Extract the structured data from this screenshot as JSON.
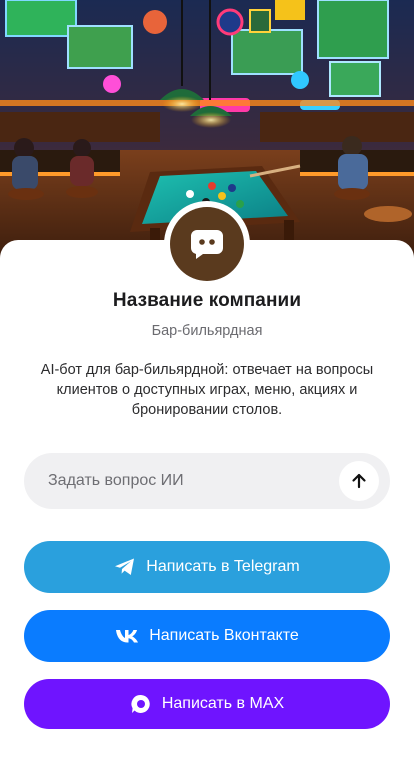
{
  "hero": {
    "image_label": "bar-billiards-interior"
  },
  "company": {
    "name": "Название компании",
    "category": "Бар-бильярдная",
    "description": "AI-бот для бар-бильярдной: отвечает на вопросы клиентов о доступных играх, меню, акциях и бронировании столов.",
    "avatar_icon": "chat-bubble-icon",
    "avatar_color": "#5a3a1e"
  },
  "ask": {
    "placeholder": "Задать вопрос ИИ",
    "value": "",
    "send_icon": "arrow-up-icon"
  },
  "buttons": {
    "telegram": {
      "label": "Написать в Telegram",
      "color": "#2aa0dd",
      "icon": "telegram-icon"
    },
    "vk": {
      "label": "Написать Вконтакте",
      "color": "#0a7cff",
      "icon": "vk-icon"
    },
    "max": {
      "label": "Написать в MAX",
      "color": "#6f14ff",
      "icon": "max-icon"
    }
  }
}
